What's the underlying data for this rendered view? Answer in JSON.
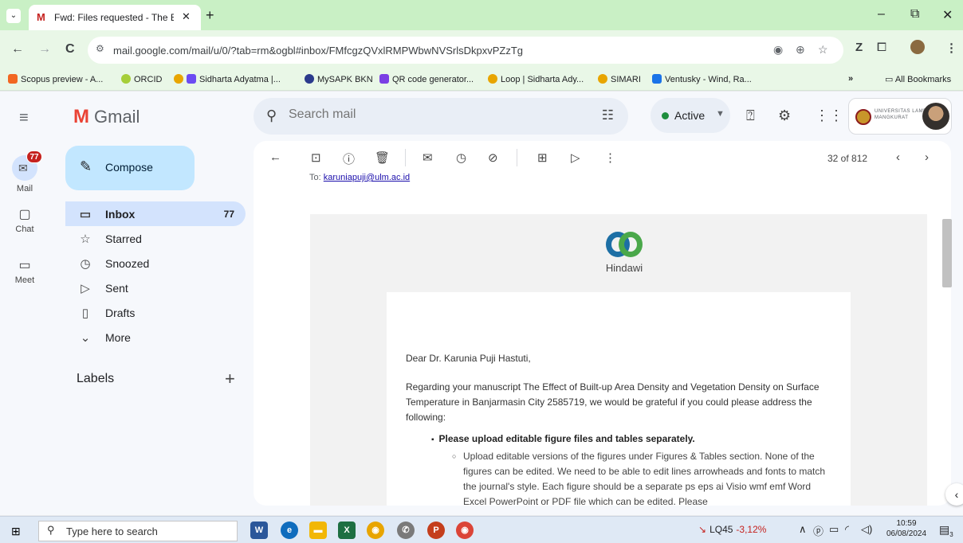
{
  "browser": {
    "tab_title": "Fwd: Files requested - The Effec",
    "tab_close": "✕",
    "new_tab": "+",
    "tab_menu": "⌄",
    "url": "mail.google.com/mail/u/0/?tab=rm&ogbl#inbox/FMfcgzQVxlRMPWbwNVSrlsDkpxvPZzTg",
    "back": "←",
    "forward": "→",
    "reload": "C",
    "site_info": "⚙",
    "win_min": "–",
    "win_max": "⧉",
    "win_close": "✕",
    "ext_z": "Z"
  },
  "bookmarks": {
    "items": [
      {
        "label": "Scopus preview - A...",
        "color": "#f26722"
      },
      {
        "label": "ORCID",
        "color": "#a6ce39"
      },
      {
        "label": "Sidharta Adyatma |...",
        "color": "#6b4bf2"
      },
      {
        "label": "MySAPK BKN",
        "color": "#2b3a8c"
      },
      {
        "label": "QR code generator...",
        "color": "#7b3fe4"
      },
      {
        "label": "Loop | Sidharta Ady...",
        "color": "#e8a500"
      },
      {
        "label": "SIMARI",
        "color": "#e8a500"
      },
      {
        "label": "Ventusky - Wind, Ra...",
        "color": "#1a73e8"
      }
    ],
    "overflow": "»",
    "all_bookmarks": "All Bookmarks"
  },
  "gmail": {
    "brand": "Gmail",
    "search_placeholder": "Search mail",
    "status": "Active",
    "org_name": "UNIVERSITAS LAMBUNG MANGKURAT",
    "rail": {
      "mail_label": "Mail",
      "mail_badge": "77",
      "chat_label": "Chat",
      "meet_label": "Meet"
    },
    "compose_label": "Compose",
    "nav": [
      {
        "label": "Inbox",
        "count": "77",
        "icon": "▭"
      },
      {
        "label": "Starred",
        "count": "",
        "icon": "☆"
      },
      {
        "label": "Snoozed",
        "count": "",
        "icon": "◷"
      },
      {
        "label": "Sent",
        "count": "",
        "icon": "▷"
      },
      {
        "label": "Drafts",
        "count": "",
        "icon": "▯"
      },
      {
        "label": "More",
        "count": "",
        "icon": "⌄"
      }
    ],
    "labels_header": "Labels",
    "labels_add": "+",
    "counter": "32 of 812",
    "to_line_prefix": "To:",
    "to_line_email": "karuniapuji@ulm.ac.id"
  },
  "email": {
    "brand_name": "Hindawi",
    "greeting": "Dear Dr. Karunia Puji Hastuti,",
    "body1": "Regarding your manuscript The Effect of Built-up Area Density and Vegetation Density on Surface Temperature in Banjarmasin City 2585719, we would be grateful if you could please address the following:",
    "bullet": "Please upload editable figure files and tables separately.",
    "sub": "Upload editable versions of the figures under Figures & Tables section. None of the figures can be edited. We need to be able to edit lines arrowheads and fonts to match the journal's style. Each figure should be a separate ps eps ai Visio wmf emf Word Excel PowerPoint or PDF file which can be edited. Please"
  },
  "taskbar": {
    "search_placeholder": "Type here to search",
    "stock_name": "LQ45",
    "stock_change": "-3,12%",
    "time": "10:59",
    "date": "06/08/2024",
    "notif_count": "3"
  }
}
